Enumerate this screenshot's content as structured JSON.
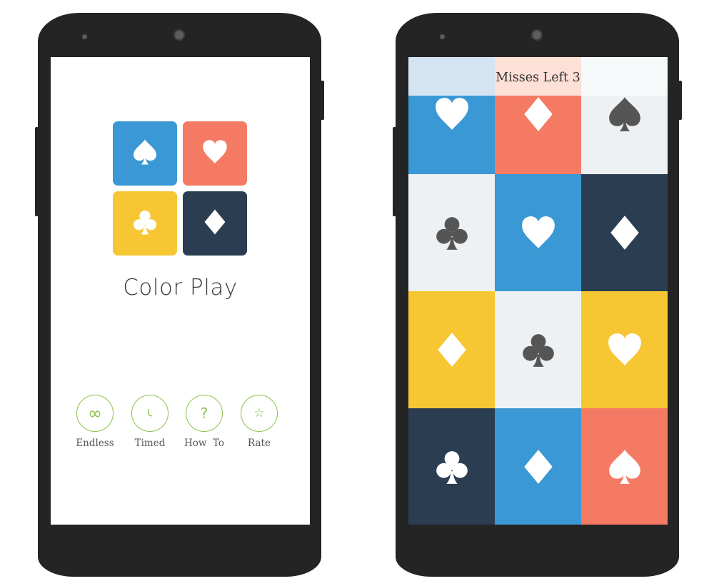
{
  "colors": {
    "blue": "#3a98d4",
    "coral": "#f47a63",
    "yellow": "#f7c733",
    "navy": "#2b3d51",
    "light": "#edf1f4",
    "icon_white": "#ffffff",
    "icon_gray": "#555555",
    "accent_green": "#8bc34a"
  },
  "home": {
    "logo_tiles": [
      {
        "suit": "spade",
        "color": "blue"
      },
      {
        "suit": "heart",
        "color": "coral"
      },
      {
        "suit": "club",
        "color": "yellow"
      },
      {
        "suit": "diamond",
        "color": "navy"
      }
    ],
    "title": "Color Play",
    "menu": [
      {
        "label": "Endless",
        "icon": "infinity-icon",
        "glyph": "∞"
      },
      {
        "label": "Timed",
        "icon": "clock-icon",
        "glyph": ""
      },
      {
        "label": "How  To",
        "icon": "question-icon",
        "glyph": "?"
      },
      {
        "label": "Rate",
        "icon": "star-icon",
        "glyph": "☆"
      }
    ]
  },
  "game": {
    "status": "Misses Left 3",
    "status_colors": [
      "#d5e4f3",
      "#fde0d6",
      "#f6f9fa"
    ],
    "tiles": [
      {
        "suit": "heart",
        "bg": "blue",
        "icon": "icon_white"
      },
      {
        "suit": "diamond",
        "bg": "coral",
        "icon": "icon_white"
      },
      {
        "suit": "spade",
        "bg": "light",
        "icon": "icon_gray"
      },
      {
        "suit": "club",
        "bg": "light",
        "icon": "icon_gray"
      },
      {
        "suit": "heart",
        "bg": "blue",
        "icon": "icon_white"
      },
      {
        "suit": "diamond",
        "bg": "navy",
        "icon": "icon_white"
      },
      {
        "suit": "diamond",
        "bg": "yellow",
        "icon": "icon_white"
      },
      {
        "suit": "club",
        "bg": "light",
        "icon": "icon_gray"
      },
      {
        "suit": "heart",
        "bg": "yellow",
        "icon": "icon_white"
      },
      {
        "suit": "club",
        "bg": "navy",
        "icon": "icon_white"
      },
      {
        "suit": "diamond",
        "bg": "blue",
        "icon": "icon_white"
      },
      {
        "suit": "spade",
        "bg": "coral",
        "icon": "icon_white"
      }
    ]
  }
}
